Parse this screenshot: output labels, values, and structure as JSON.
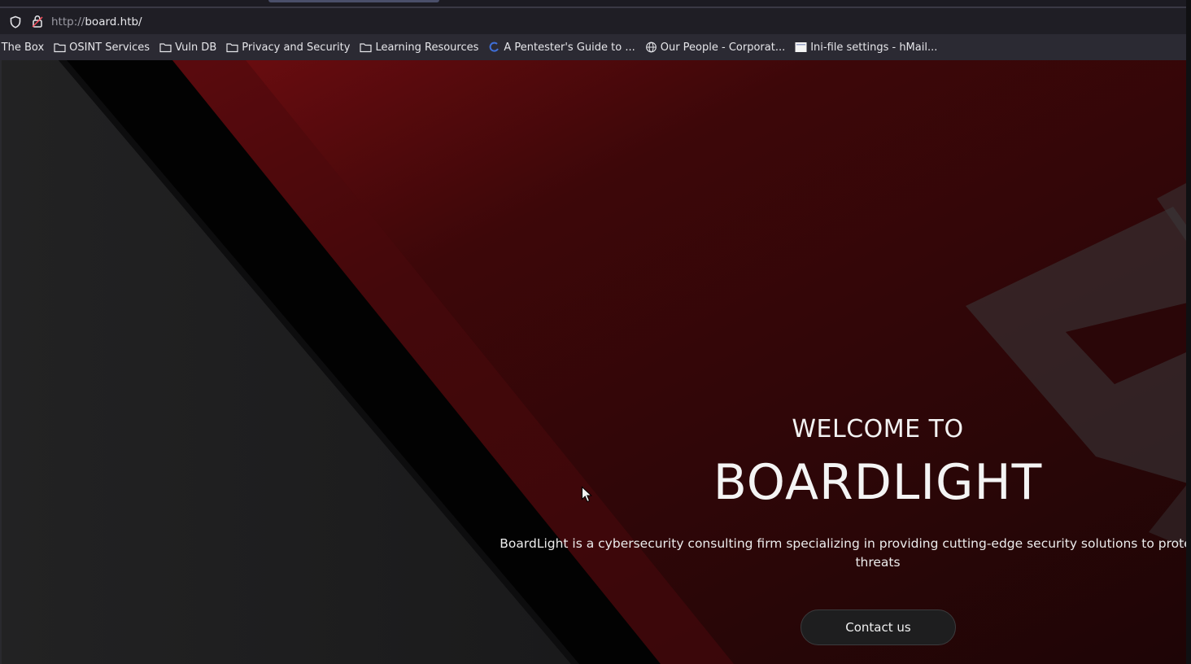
{
  "browser": {
    "url_protocol": "http://",
    "url_host": "board.htb/",
    "bookmarks": [
      {
        "label": "k The Box",
        "icon": "hackthebox-icon"
      },
      {
        "label": "OSINT Services",
        "icon": "folder-icon"
      },
      {
        "label": "Vuln DB",
        "icon": "folder-icon"
      },
      {
        "label": "Privacy and Security",
        "icon": "folder-icon"
      },
      {
        "label": "Learning Resources",
        "icon": "folder-icon"
      },
      {
        "label": "A Pentester's Guide to ...",
        "icon": "loading-icon"
      },
      {
        "label": "Our People - Corporat...",
        "icon": "globe-icon"
      },
      {
        "label": "Ini-file settings - hMail...",
        "icon": "page-icon"
      }
    ]
  },
  "hero": {
    "welcome": "WELCOME TO",
    "brand": "BOARDLIGHT",
    "tagline_line1": "BoardLight is a cybersecurity consulting firm specializing in providing cutting-edge security solutions to protect your bu",
    "tagline_line2": "threats",
    "contact_label": "Contact us"
  },
  "colors": {
    "page_dark": "#1b1b1c",
    "hero_red": "#3a0a0c",
    "accent_red": "#7a0e12"
  }
}
